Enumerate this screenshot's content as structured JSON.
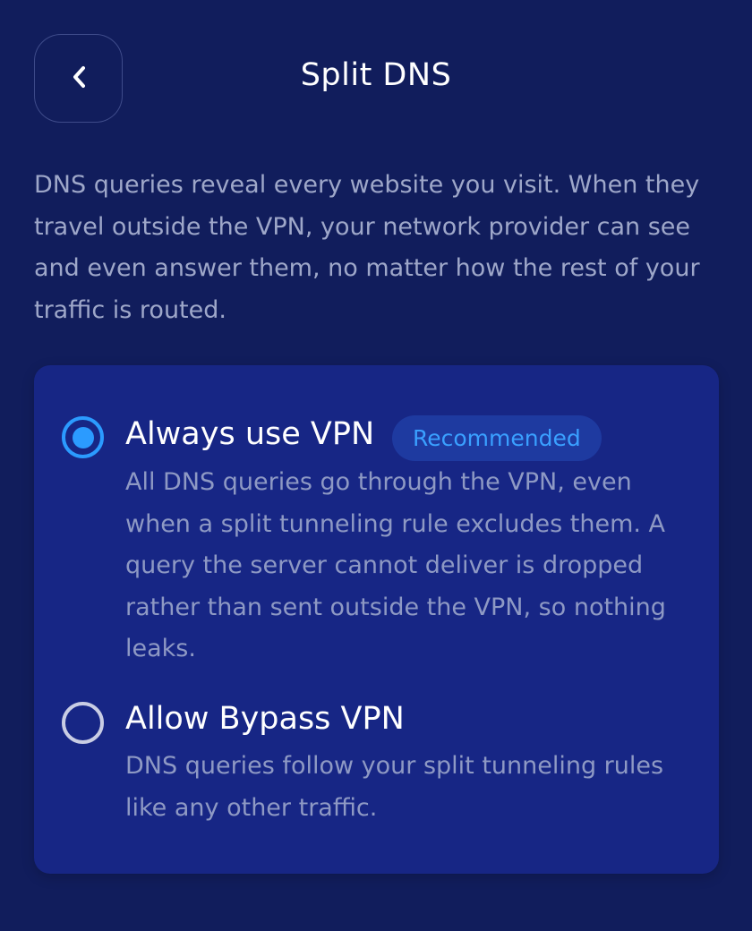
{
  "header": {
    "title": "Split DNS",
    "back_icon": "chevron-left-icon"
  },
  "description": "DNS queries reveal every website you visit. When they travel outside the VPN, your network provider can see and even answer them, no matter how the rest of your traffic is routed.",
  "options": [
    {
      "label": "Always use VPN",
      "badge": "Recommended",
      "selected": true,
      "description": "All DNS queries go through the VPN, even when a split tunneling rule excludes them. A query the server cannot deliver is dropped rather than sent outside the VPN, so nothing leaks."
    },
    {
      "label": "Allow Bypass VPN",
      "selected": false,
      "description": "DNS queries follow your split tunneling rules like any other traffic."
    }
  ],
  "colors": {
    "background": "#111d5c",
    "card": "#172685",
    "accent": "#2b9bff",
    "muted_text": "#8e99c4"
  }
}
